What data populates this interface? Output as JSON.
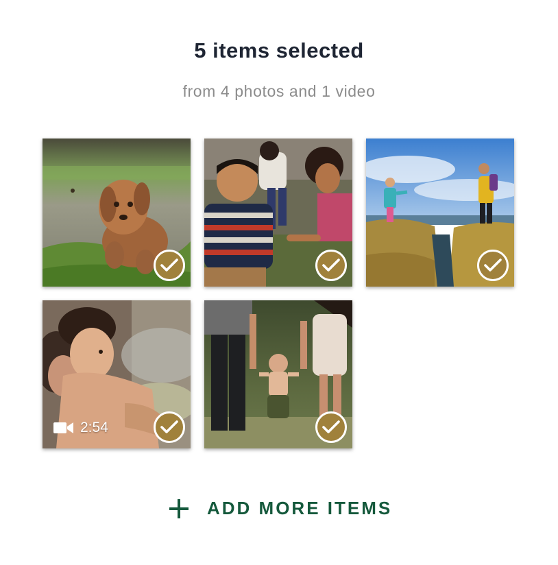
{
  "header": {
    "title": "5 items selected",
    "subtitle": "from 4 photos and 1 video"
  },
  "items": [
    {
      "name": "dog-photo",
      "type": "photo",
      "selected": true,
      "icon": "check-icon"
    },
    {
      "name": "kids-playing-photo",
      "type": "photo",
      "selected": true,
      "icon": "check-icon"
    },
    {
      "name": "coastal-hike-photo",
      "type": "photo",
      "selected": true,
      "icon": "check-icon"
    },
    {
      "name": "boy-pool-video",
      "type": "video",
      "selected": true,
      "icon": "check-icon",
      "video_icon": "video-camera-icon",
      "duration": "2:54"
    },
    {
      "name": "toddler-walking-photo",
      "type": "photo",
      "selected": true,
      "icon": "check-icon"
    }
  ],
  "add_more": {
    "icon": "plus-icon",
    "label": "ADD MORE ITEMS"
  },
  "colors": {
    "title": "#1e2533",
    "subtitle": "#8c8c8c",
    "check_badge": "#a0813b",
    "accent_green": "#15593c"
  }
}
